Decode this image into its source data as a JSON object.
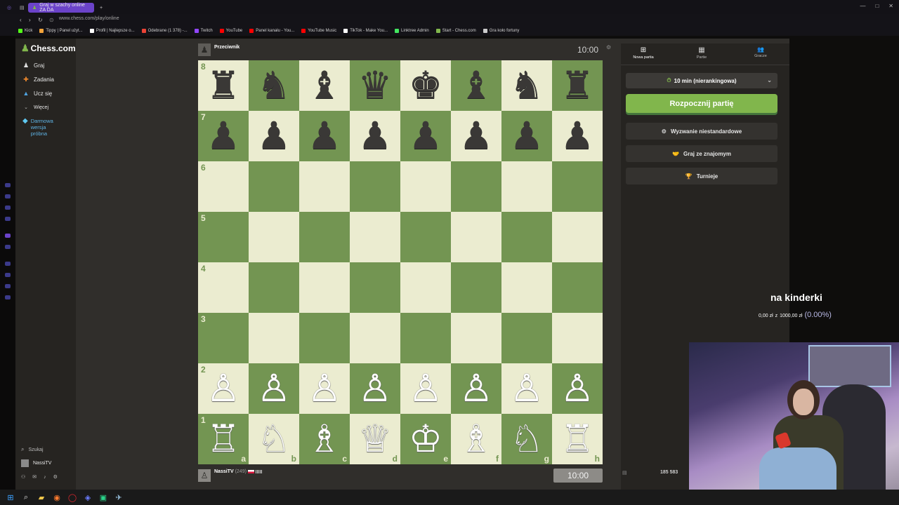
{
  "browser": {
    "tab_title": "Graj w szachy online ZA DA",
    "url": "www.chess.com/play/online",
    "bookmarks": [
      {
        "label": "Kick",
        "color": "#53fc18"
      },
      {
        "label": "Tippy | Panel użyt...",
        "color": "#f2a33a"
      },
      {
        "label": "Profil | Najlepsze o...",
        "color": "#ffffff"
      },
      {
        "label": "Odebrane (1 378) -...",
        "color": "#ea4335"
      },
      {
        "label": "Twitch",
        "color": "#9146ff"
      },
      {
        "label": "YouTube",
        "color": "#ff0000"
      },
      {
        "label": "Panel kanału - You...",
        "color": "#ff0000"
      },
      {
        "label": "YouTube Music",
        "color": "#ff0000"
      },
      {
        "label": "TikTok - Make You...",
        "color": "#ffffff"
      },
      {
        "label": "Linktree Admin",
        "color": "#43e660"
      },
      {
        "label": "Start - Chess.com",
        "color": "#81b64c"
      },
      {
        "label": "Gra koło fortuny",
        "color": "#cccccc"
      }
    ]
  },
  "sidebar": {
    "logo": "Chess.com",
    "items": [
      {
        "label": "Graj",
        "icon": "pawn-icon"
      },
      {
        "label": "Zadania",
        "icon": "puzzle-icon"
      },
      {
        "label": "Ucz się",
        "icon": "learn-icon"
      },
      {
        "label": "Więcej",
        "icon": "chevron-down-icon"
      }
    ],
    "trial": "Darmowa wersja próbna",
    "search": "Szukaj",
    "user": "NassiTV"
  },
  "game": {
    "opponent": "Przeciwnik",
    "opponent_clock": "10:00",
    "player": "NassiTV",
    "player_rating": "(249)",
    "player_clock": "10:00",
    "ranks": [
      "8",
      "7",
      "6",
      "5",
      "4",
      "3",
      "2",
      "1"
    ],
    "files": [
      "a",
      "b",
      "c",
      "d",
      "e",
      "f",
      "g",
      "h"
    ],
    "board": [
      [
        "♜",
        "♞",
        "♝",
        "♛",
        "♚",
        "♝",
        "♞",
        "♜"
      ],
      [
        "♟",
        "♟",
        "♟",
        "♟",
        "♟",
        "♟",
        "♟",
        "♟"
      ],
      [
        "",
        "",
        "",
        "",
        "",
        "",
        "",
        ""
      ],
      [
        "",
        "",
        "",
        "",
        "",
        "",
        "",
        ""
      ],
      [
        "",
        "",
        "",
        "",
        "",
        "",
        "",
        ""
      ],
      [
        "",
        "",
        "",
        "",
        "",
        "",
        "",
        ""
      ],
      [
        "♙",
        "♙",
        "♙",
        "♙",
        "♙",
        "♙",
        "♙",
        "♙"
      ],
      [
        "♖",
        "♘",
        "♗",
        "♕",
        "♔",
        "♗",
        "♘",
        "♖"
      ]
    ]
  },
  "panel": {
    "tabs": [
      {
        "label": "Nowa partia",
        "icon": "⊞"
      },
      {
        "label": "Partie",
        "icon": "▦"
      },
      {
        "label": "Gracze",
        "icon": "👥"
      }
    ],
    "time_control": "10 min (nierankingowa)",
    "start_button": "Rozpocznij partię",
    "options": [
      {
        "label": "Wyzwanie niestandardowe",
        "icon": "⚙"
      },
      {
        "label": "Graj ze znajomym",
        "icon": "🤝"
      },
      {
        "label": "Turnieje",
        "icon": "🏆"
      }
    ],
    "online_count": "185 583"
  },
  "overlay": {
    "title": "na kinderki",
    "amount": "0,00 zł",
    "separator": "z",
    "goal": "1000,00 zł",
    "percent": "(0.00%)"
  },
  "colors": {
    "board_light": "#ebecd0",
    "board_dark": "#739552",
    "accent_green": "#81b64c",
    "tab_active": "#6b43c9"
  }
}
